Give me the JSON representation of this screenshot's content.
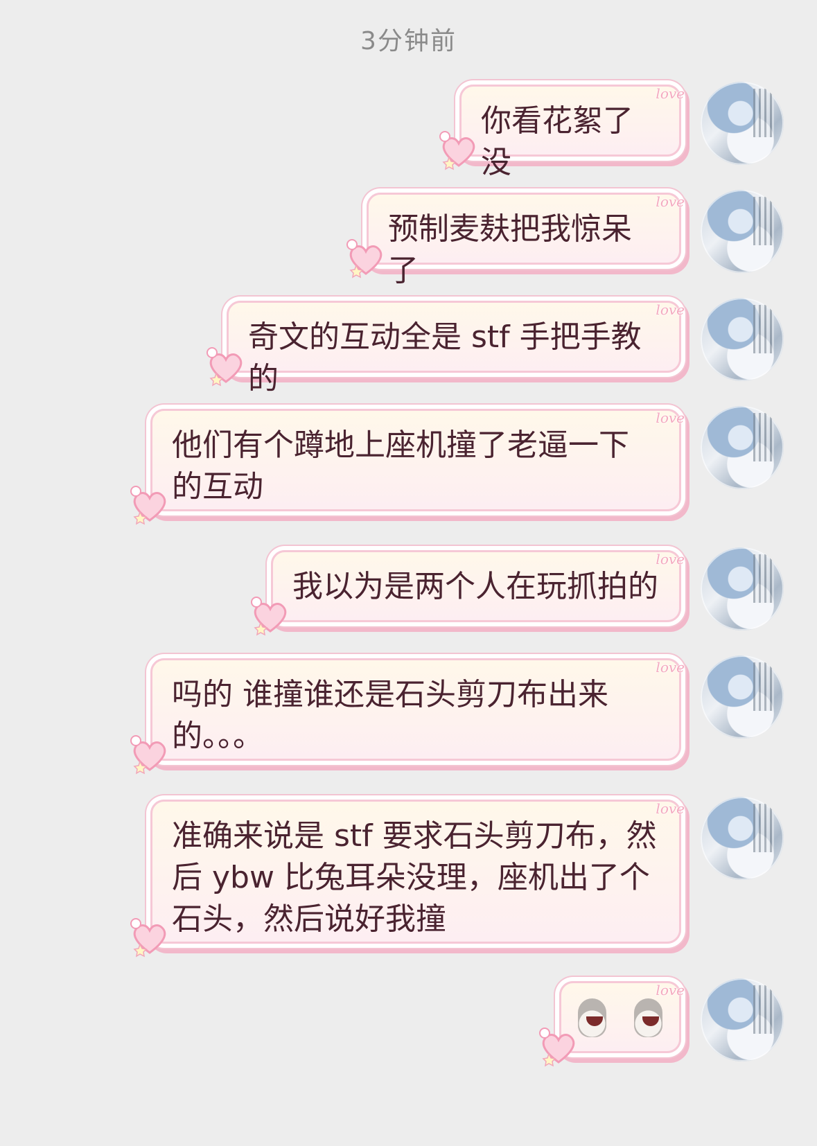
{
  "timestamp": "3分钟前",
  "decoration_text": "love",
  "messages": [
    {
      "text": "你看花絮了没"
    },
    {
      "text": "预制麦麸把我惊呆了"
    },
    {
      "text": "奇文的互动全是 stf 手把手教的"
    },
    {
      "text": "他们有个蹲地上座机撞了老逼一下\n的互动"
    },
    {
      "text": "我以为是两个人在玩抓拍的"
    },
    {
      "text": "吗的 谁撞谁还是石头剪刀布出来\n的。。。"
    },
    {
      "text": "准确来说是 stf 要求石头剪刀布，然\n后 ybw 比兔耳朵没理，座机出了个\n石头，然后说好我撞"
    }
  ],
  "last_message": {
    "icons": [
      "crying-sheep-emoji-icon",
      "crying-sheep-emoji-icon"
    ]
  },
  "colors": {
    "bubble_border": "#f6c8d6",
    "bubble_bg_top": "#fff8ea",
    "bubble_bg_bottom": "#fdeef2",
    "text": "#4a2330"
  }
}
